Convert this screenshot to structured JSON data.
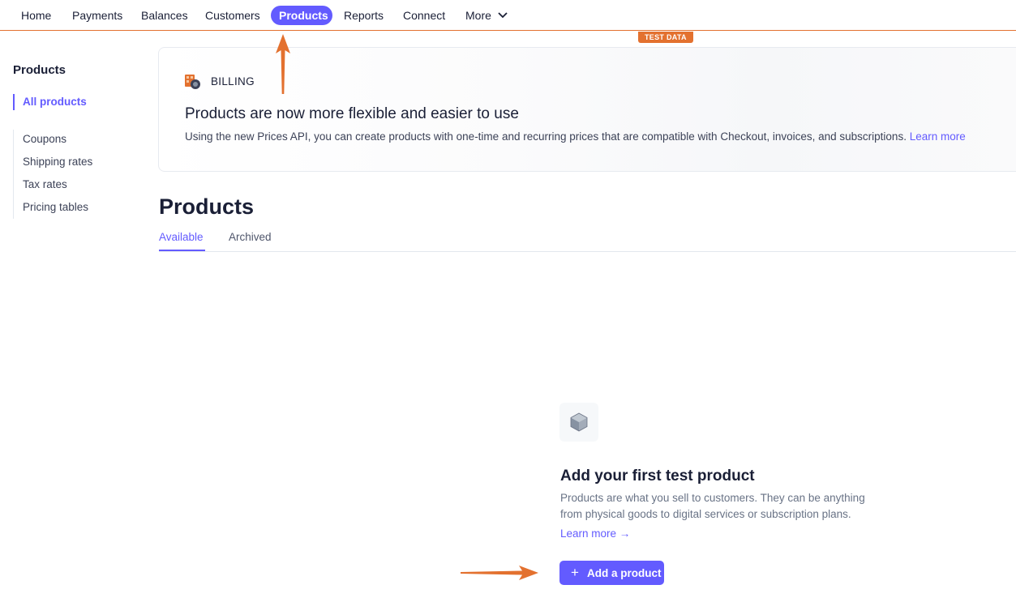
{
  "topnav": {
    "items": [
      {
        "label": "Home"
      },
      {
        "label": "Payments"
      },
      {
        "label": "Balances"
      },
      {
        "label": "Customers"
      },
      {
        "label": "Products",
        "active": true
      },
      {
        "label": "Reports"
      },
      {
        "label": "Connect"
      },
      {
        "label": "More"
      }
    ],
    "test_badge": "TEST DATA"
  },
  "sidebar": {
    "title": "Products",
    "items": [
      {
        "label": "All products",
        "active": true
      },
      {
        "label": "Coupons"
      },
      {
        "label": "Shipping rates"
      },
      {
        "label": "Tax rates"
      },
      {
        "label": "Pricing tables"
      }
    ]
  },
  "banner": {
    "label": "BILLING",
    "title": "Products are now more flexible and easier to use",
    "description": "Using the new Prices API, you can create products with one-time and recurring prices that are compatible with Checkout, invoices, and subscriptions.",
    "link": "Learn more"
  },
  "main": {
    "title": "Products",
    "tabs": [
      {
        "label": "Available",
        "active": true
      },
      {
        "label": "Archived"
      }
    ]
  },
  "empty_state": {
    "title": "Add your first test product",
    "description": "Products are what you sell to customers. They can be anything from physical goods to digital services or subscription plans.",
    "link": "Learn more →",
    "button": "Add a product",
    "icon": "box-icon"
  },
  "colors": {
    "accent": "#635bff",
    "test_mode": "#e3712f",
    "annotation_arrow": "#e3712f"
  }
}
